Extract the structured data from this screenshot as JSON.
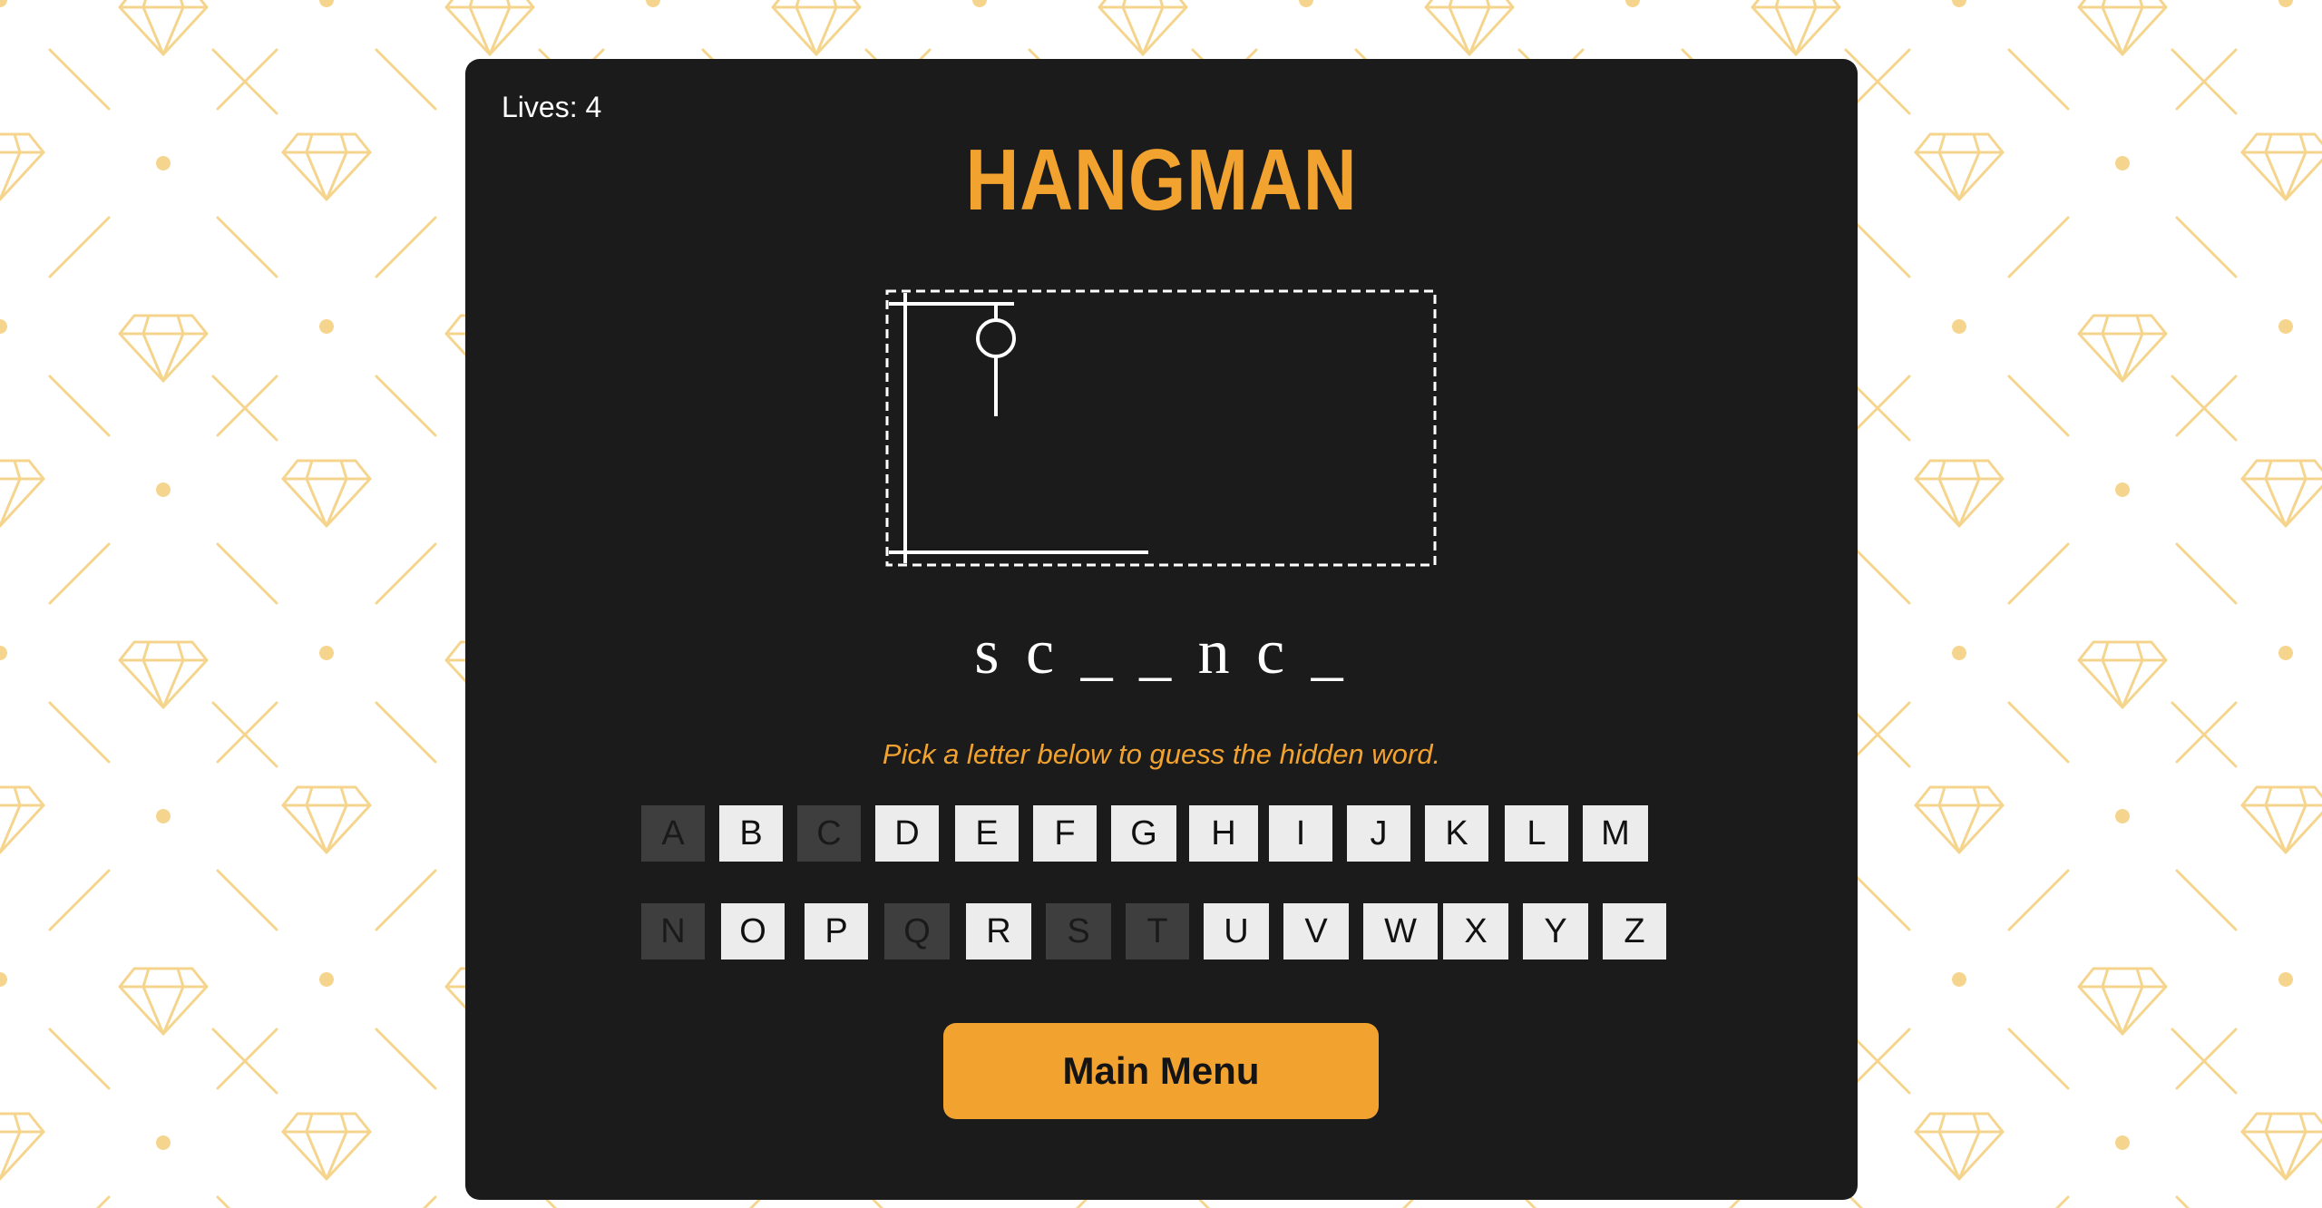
{
  "game": {
    "lives_label": "Lives: 4",
    "lives": 4,
    "title": "HANGMAN",
    "word_display": "s c _ _ n c _",
    "hint": "Pick a letter below to guess the hidden word.",
    "menu_label": "Main Menu"
  },
  "keyboard": {
    "row1": [
      {
        "letter": "A",
        "used": true
      },
      {
        "letter": "B",
        "used": false
      },
      {
        "letter": "C",
        "used": true
      },
      {
        "letter": "D",
        "used": false
      },
      {
        "letter": "E",
        "used": false
      },
      {
        "letter": "F",
        "used": false
      },
      {
        "letter": "G",
        "used": false
      },
      {
        "letter": "H",
        "used": false
      },
      {
        "letter": "I",
        "used": false
      },
      {
        "letter": "J",
        "used": false
      },
      {
        "letter": "K",
        "used": false
      },
      {
        "letter": "L",
        "used": false
      },
      {
        "letter": "M",
        "used": false
      }
    ],
    "row2": [
      {
        "letter": "N",
        "used": true
      },
      {
        "letter": "O",
        "used": false
      },
      {
        "letter": "P",
        "used": false
      },
      {
        "letter": "Q",
        "used": true
      },
      {
        "letter": "R",
        "used": false
      },
      {
        "letter": "S",
        "used": true
      },
      {
        "letter": "T",
        "used": true
      },
      {
        "letter": "U",
        "used": false
      },
      {
        "letter": "V",
        "used": false
      },
      {
        "letter": "W",
        "used": false
      },
      {
        "letter": "X",
        "used": false
      },
      {
        "letter": "Y",
        "used": false
      },
      {
        "letter": "Z",
        "used": false
      }
    ]
  },
  "hangman_parts_shown": [
    "gallows",
    "rope",
    "head",
    "body"
  ],
  "colors": {
    "accent": "#f2a22f",
    "card_bg": "#1b1b1b",
    "key_bg": "#ececec",
    "key_used_bg": "#3e3e3e",
    "pattern": "#f5d58e"
  }
}
